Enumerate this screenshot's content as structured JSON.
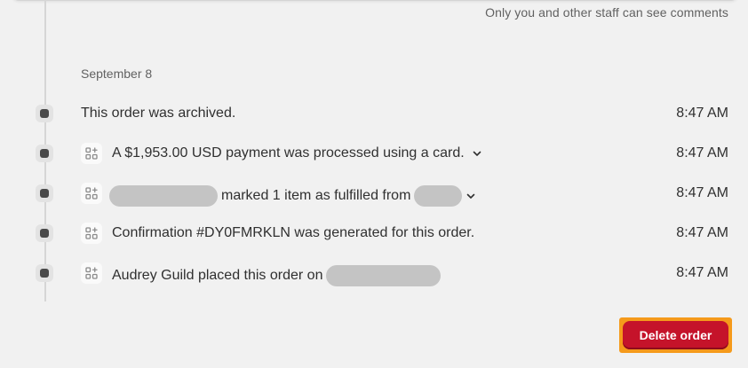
{
  "comments": {
    "staff_note": "Only you and other staff can see comments"
  },
  "timeline": {
    "date_heading": "September 8",
    "events": [
      {
        "text": "This order was archived.",
        "time": "8:47 AM",
        "icon": "none"
      },
      {
        "text": "A $1,953.00 USD payment was processed using a card.",
        "time": "8:47 AM",
        "icon": "app-icon",
        "expandable": true
      },
      {
        "text_after_redaction": "marked 1 item as fulfilled from",
        "time": "8:47 AM",
        "icon": "app-icon",
        "expandable": true
      },
      {
        "text": "Confirmation #DY0FMRKLN was generated for this order.",
        "time": "8:47 AM",
        "icon": "app-icon"
      },
      {
        "text": "Audrey Guild placed this order on",
        "time": "8:47 AM",
        "icon": "app-icon"
      }
    ]
  },
  "actions": {
    "delete_label": "Delete order"
  },
  "colors": {
    "danger": "#c5132a",
    "highlight": "#f59a1b",
    "background": "#f1f1f1"
  }
}
